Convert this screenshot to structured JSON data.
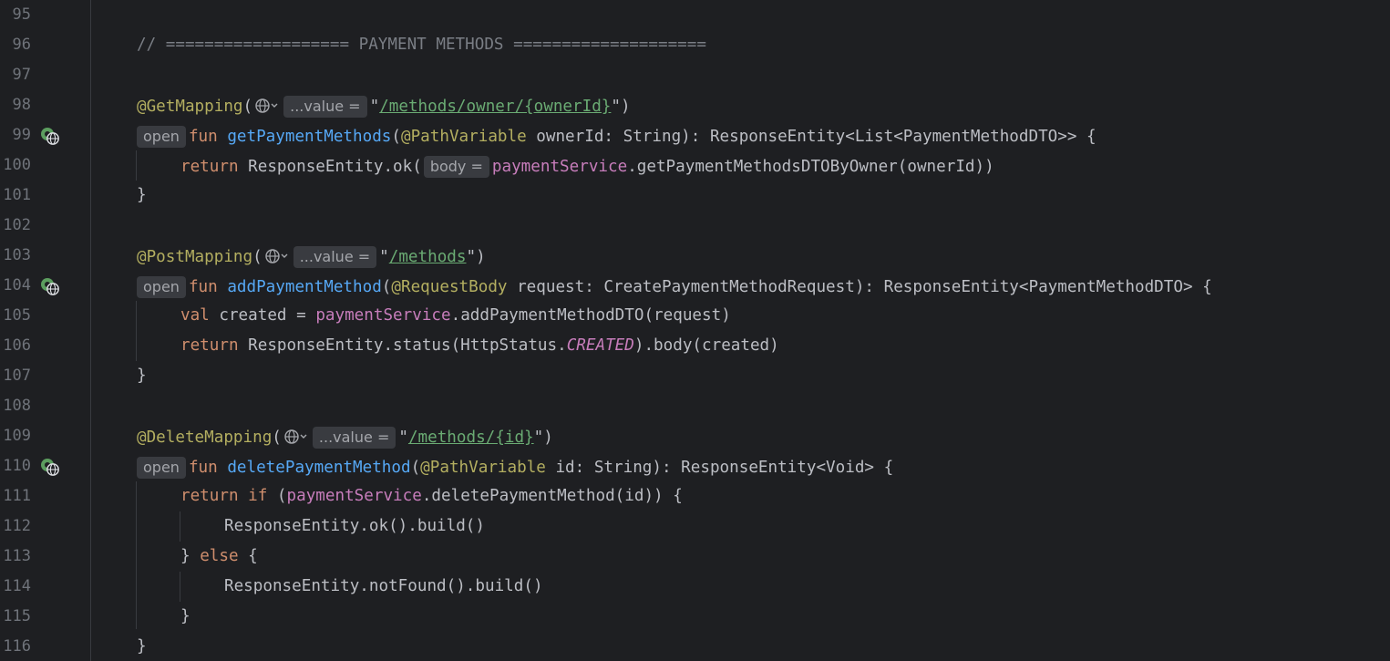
{
  "editor": {
    "lines": [
      {
        "num": "95"
      },
      {
        "num": "96",
        "comment": "// =================== PAYMENT METHODS ===================="
      },
      {
        "num": "97"
      },
      {
        "num": "98",
        "annotation": "@GetMapping",
        "hint": "...value =",
        "path": "/methods/owner/{ownerId}"
      },
      {
        "num": "99",
        "open_hint": "open",
        "fun": "fun",
        "name": "getPaymentMethods",
        "param_ann": "@PathVariable",
        "rest": " ownerId: String): ResponseEntity<List<PaymentMethodDTO>> {"
      },
      {
        "num": "100",
        "ret": "return",
        "call": " ResponseEntity.ok(",
        "hint": "body =",
        "field": "paymentService",
        "tail": ".getPaymentMethodsDTOByOwner(ownerId))"
      },
      {
        "num": "101",
        "text": "}"
      },
      {
        "num": "102"
      },
      {
        "num": "103",
        "annotation": "@PostMapping",
        "hint": "...value =",
        "path": "/methods"
      },
      {
        "num": "104",
        "open_hint": "open",
        "fun": "fun",
        "name": "addPaymentMethod",
        "param_ann": "@RequestBody",
        "rest": " request: CreatePaymentMethodRequest): ResponseEntity<PaymentMethodDTO> {"
      },
      {
        "num": "105",
        "kw": "val",
        "pre": " created = ",
        "field": "paymentService",
        "tail": ".addPaymentMethodDTO(request)"
      },
      {
        "num": "106",
        "ret": "return",
        "pre": " ResponseEntity.status(HttpStatus.",
        "constant": "CREATED",
        "tail": ").body(created)"
      },
      {
        "num": "107",
        "text": "}"
      },
      {
        "num": "108"
      },
      {
        "num": "109",
        "annotation": "@DeleteMapping",
        "hint": "...value =",
        "path": "/methods/{id}"
      },
      {
        "num": "110",
        "open_hint": "open",
        "fun": "fun",
        "name": "deletePaymentMethod",
        "param_ann": "@PathVariable",
        "rest": " id: String): ResponseEntity<Void> {"
      },
      {
        "num": "111",
        "ret": "return",
        "kw2": "if",
        "pre": " (",
        "field": "paymentService",
        "tail": ".deletePaymentMethod(id)) {"
      },
      {
        "num": "112",
        "text": "ResponseEntity.ok().build()"
      },
      {
        "num": "113",
        "pre": "} ",
        "kw": "else",
        "tail": " {"
      },
      {
        "num": "114",
        "text": "ResponseEntity.notFound().build()"
      },
      {
        "num": "115",
        "text": "}"
      },
      {
        "num": "116",
        "text": "}"
      }
    ],
    "colors": {
      "background": "#1e1f22",
      "keyword": "#cf8e6d",
      "annotation": "#b3ae60",
      "function": "#56a8f5",
      "string": "#6aab73",
      "field": "#c77dbb",
      "comment": "#7a7e85"
    },
    "gutter_icon": "run-endpoint-globe-icon",
    "hint_icon": "globe-chevron-icon"
  }
}
